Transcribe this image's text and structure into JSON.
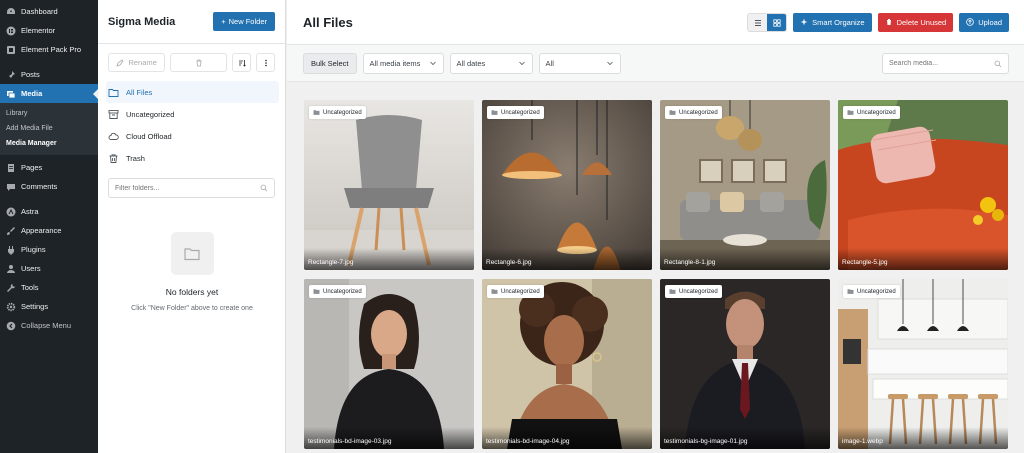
{
  "wp_menu": {
    "items_top": [
      {
        "label": "Dashboard",
        "icon": "dashboard-icon"
      },
      {
        "label": "Elementor",
        "icon": "elementor-icon"
      },
      {
        "label": "Element Pack Pro",
        "icon": "element-pack-icon"
      }
    ],
    "items_media": [
      {
        "label": "Posts",
        "icon": "pin-icon"
      },
      {
        "label": "Media",
        "icon": "media-icon"
      }
    ],
    "media_sub": [
      "Library",
      "Add Media File",
      "Media Manager"
    ],
    "items_rest": [
      {
        "label": "Pages",
        "icon": "pages-icon"
      },
      {
        "label": "Comments",
        "icon": "comments-icon"
      }
    ],
    "items_bottom": [
      {
        "label": "Astra",
        "icon": "astra-icon"
      },
      {
        "label": "Appearance",
        "icon": "brush-icon"
      },
      {
        "label": "Plugins",
        "icon": "plugins-icon"
      },
      {
        "label": "Users",
        "icon": "users-icon"
      },
      {
        "label": "Tools",
        "icon": "wrench-icon"
      },
      {
        "label": "Settings",
        "icon": "settings-icon"
      },
      {
        "label": "Collapse Menu",
        "icon": "collapse-icon"
      }
    ]
  },
  "folder_panel": {
    "title": "Sigma Media",
    "new_folder_label": "New Folder",
    "rename_label": "Rename",
    "folders": [
      {
        "label": "All Files",
        "icon": "folder-icon",
        "active": true
      },
      {
        "label": "Uncategorized",
        "icon": "archive-icon",
        "active": false
      },
      {
        "label": "Cloud Offload",
        "icon": "cloud-icon",
        "active": false
      },
      {
        "label": "Trash",
        "icon": "trash-icon",
        "active": false
      }
    ],
    "filter_placeholder": "Filter folders...",
    "empty_title": "No folders yet",
    "empty_subtitle": "Click \"New Folder\" above to create one"
  },
  "main": {
    "title": "All Files",
    "smart_organize_label": "Smart Organize",
    "delete_unused_label": "Delete Unused",
    "upload_label": "Upload",
    "bulk_select_label": "Bulk Select",
    "filter_media": "All media items",
    "filter_dates": "All dates",
    "filter_all": "All",
    "search_placeholder": "Search media...",
    "files": [
      {
        "name": "Rectangle-7.jpg",
        "tag": "Uncategorized",
        "scene": "chair"
      },
      {
        "name": "Rectangle-6.jpg",
        "tag": "Uncategorized",
        "scene": "lamps"
      },
      {
        "name": "Rectangle-8-1.jpg",
        "tag": "Uncategorized",
        "scene": "living-room"
      },
      {
        "name": "Rectangle-5.jpg",
        "tag": "Uncategorized",
        "scene": "sofa"
      },
      {
        "name": "testimonials-bd-image-03.jpg",
        "tag": "Uncategorized",
        "scene": "woman-dark"
      },
      {
        "name": "testimonials-bd-image-04.jpg",
        "tag": "Uncategorized",
        "scene": "woman-curly"
      },
      {
        "name": "testimonials-bg-image-01.jpg",
        "tag": "Uncategorized",
        "scene": "man-suit"
      },
      {
        "name": "image-1.webp",
        "tag": "Uncategorized",
        "scene": "kitchen"
      }
    ]
  },
  "colors": {
    "accent": "#2271b1",
    "danger": "#d63638",
    "sidebar_bg": "#1d2327"
  }
}
